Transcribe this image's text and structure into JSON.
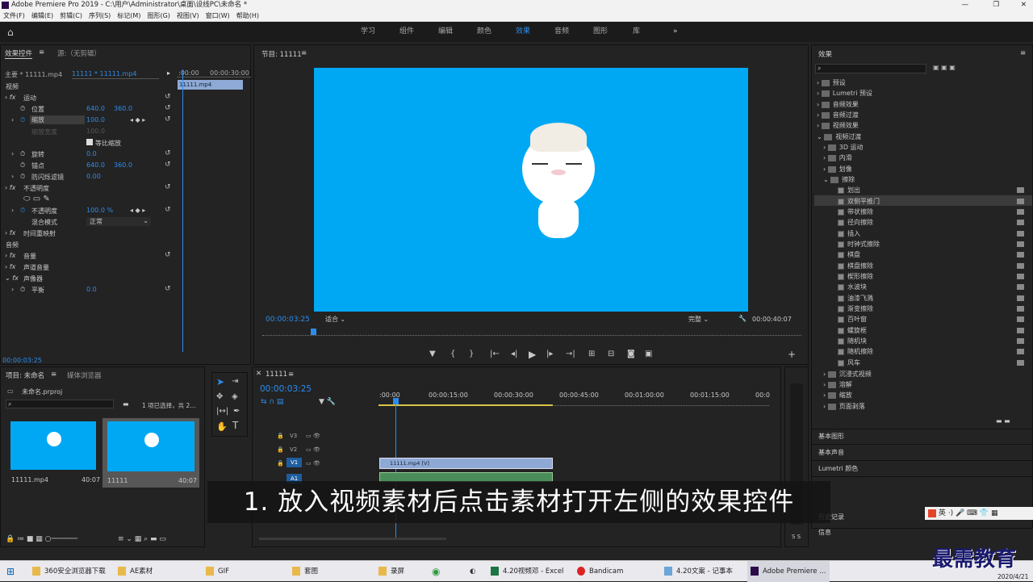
{
  "app": {
    "title": "Adobe Premiere Pro 2019 - C:\\用户\\Administrator\\桌面\\设线PC\\未命名 *"
  },
  "menu": [
    "文件(F)",
    "编辑(E)",
    "剪辑(C)",
    "序列(S)",
    "标记(M)",
    "图形(G)",
    "视图(V)",
    "窗口(W)",
    "帮助(H)"
  ],
  "workspaces": [
    "学习",
    "组件",
    "编辑",
    "颜色",
    "效果",
    "音频",
    "图形",
    "库"
  ],
  "active_workspace": "效果",
  "effect_controls": {
    "tab": "效果控件",
    "source_tab": "源:（无剪辑）",
    "master": "主要 * 11111.mp4",
    "clip": "11111 * 11111.mp4",
    "ruler_start": ":00:00",
    "ruler_end": "00:00:30:00",
    "clip_chip": "11111.mp4",
    "video_header": "视频",
    "audio_header": "音频",
    "motion": "运动",
    "position": "位置",
    "pos_x": "640.0",
    "pos_y": "360.0",
    "scale": "缩放",
    "scale_val": "100.0",
    "scale_width": "缩放宽度",
    "scale_width_val": "100.0",
    "uniform": "等比缩放",
    "rotation": "旋转",
    "rotation_val": "0.0",
    "anchor": "锚点",
    "anchor_x": "640.0",
    "anchor_y": "360.0",
    "flicker": "防闪烁滤镜",
    "flicker_val": "0.00",
    "opacity_group": "不透明度",
    "opacity": "不透明度",
    "opacity_val": "100.0 %",
    "blend": "混合模式",
    "blend_val": "正常",
    "time_remap": "时间重映射",
    "volume": "音量",
    "channel_volume": "声道音量",
    "panner": "声像器",
    "balance": "平衡",
    "balance_val": "0.0",
    "footer_time": "00:00:03:25"
  },
  "program": {
    "label": "节目: 11111",
    "timecode": "00:00:03:25",
    "fit": "适合",
    "quality": "完整",
    "duration": "00:00:40:07"
  },
  "effects_panel": {
    "title": "效果",
    "top": [
      "预设",
      "Lumetri 预设",
      "音频效果",
      "音频过渡",
      "视频效果",
      "视频过渡"
    ],
    "sub": [
      "3D 运动",
      "内滑",
      "划像",
      "擦除"
    ],
    "wipes": [
      "划出",
      "双侧平推门",
      "带状擦除",
      "径向擦除",
      "插入",
      "时钟式擦除",
      "棋盘",
      "棋盘擦除",
      "楔形擦除",
      "水波块",
      "油漆飞溅",
      "渐变擦除",
      "百叶窗",
      "螺旋框",
      "随机块",
      "随机擦除",
      "风车"
    ],
    "sub2": [
      "沉浸式视频",
      "溶解",
      "缩放",
      "页面剥落"
    ],
    "bottom": [
      "基本图形",
      "基本声音",
      "Lumetri 颜色",
      "历史记录",
      "信息"
    ]
  },
  "project": {
    "tab": "项目: 未命名",
    "browser_tab": "媒体浏览器",
    "file": "未命名.prproj",
    "selection": "1 项已选择，共 2...",
    "items": [
      {
        "name": "11111.mp4",
        "dur": "40:07"
      },
      {
        "name": "11111",
        "dur": "40:07"
      }
    ]
  },
  "timeline": {
    "tab": "11111",
    "timecode": "00:00:03:25",
    "ticks": [
      ":00:00",
      "00:00:15:00",
      "00:00:30:00",
      "00:00:45:00",
      "00:01:00:00",
      "00:01:15:00",
      "00:0"
    ],
    "tracks": [
      "V3",
      "V2",
      "V1",
      "A1"
    ],
    "clip": "11111.mp4 [V]"
  },
  "subtitle": "1. 放入视频素材后点击素材打开左侧的效果控件",
  "watermark": "最需教育",
  "taskbar": [
    {
      "label": "360安全浏览器下载"
    },
    {
      "label": "AE素材"
    },
    {
      "label": "GIF"
    },
    {
      "label": "套图"
    },
    {
      "label": "录屏"
    },
    {
      "label": "4.20视频邓 - Excel"
    },
    {
      "label": "Bandicam"
    },
    {
      "label": "4.20文案 - 记事本"
    },
    {
      "label": "Adobe Premiere ..."
    }
  ],
  "clock": {
    "date": "2020/4/21"
  },
  "ime": "英"
}
